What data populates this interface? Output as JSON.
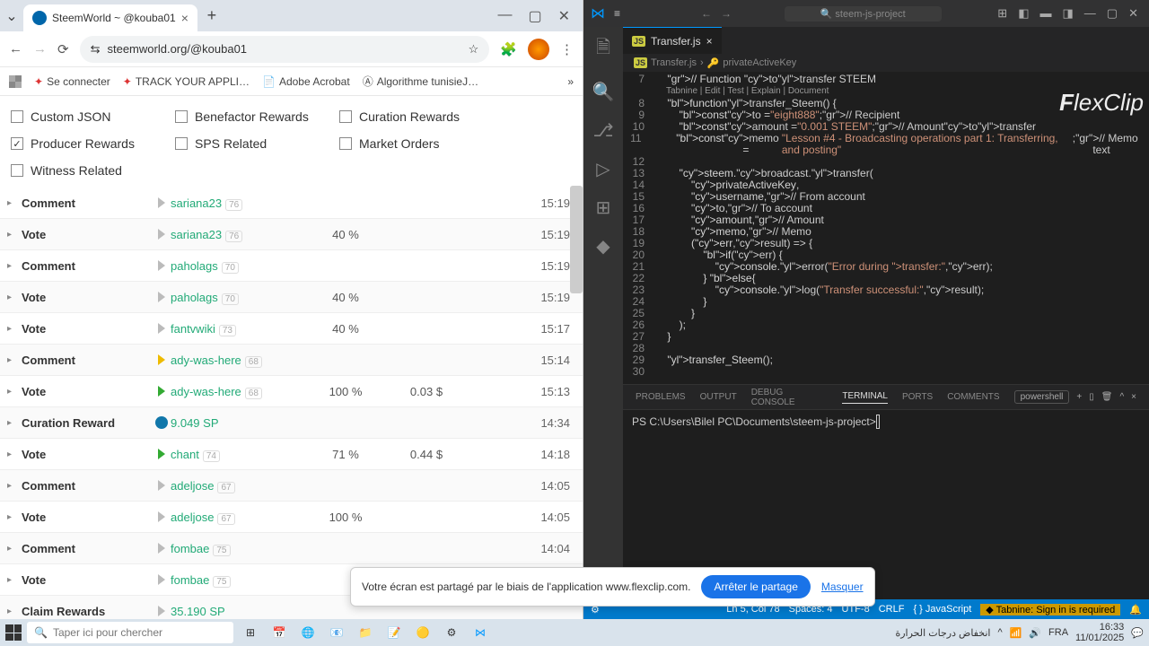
{
  "browser": {
    "tab_title": "SteemWorld ~ @kouba01",
    "url": "steemworld.org/@kouba01",
    "bookmarks": {
      "apps": "",
      "connect": "Se connecter",
      "track": "TRACK YOUR APPLI…",
      "acrobat": "Adobe Acrobat",
      "algo": "Algorithme tunisieJ…"
    },
    "filters": {
      "custom_json": "Custom JSON",
      "benefactor": "Benefactor Rewards",
      "curation": "Curation Rewards",
      "producer": "Producer Rewards",
      "sps": "SPS Related",
      "market": "Market Orders",
      "witness": "Witness Related"
    },
    "ops": [
      {
        "type": "Comment",
        "user": "sariana23",
        "rep": "76",
        "tri": "n",
        "pct": "",
        "amt": "",
        "time": "15:19"
      },
      {
        "type": "Vote",
        "user": "sariana23",
        "rep": "76",
        "tri": "n",
        "pct": "40 %",
        "amt": "",
        "time": "15:19"
      },
      {
        "type": "Comment",
        "user": "paholags",
        "rep": "70",
        "tri": "n",
        "pct": "",
        "amt": "",
        "time": "15:19"
      },
      {
        "type": "Vote",
        "user": "paholags",
        "rep": "70",
        "tri": "n",
        "pct": "40 %",
        "amt": "",
        "time": "15:19"
      },
      {
        "type": "Vote",
        "user": "fantvwiki",
        "rep": "73",
        "tri": "n",
        "pct": "40 %",
        "amt": "",
        "time": "15:17"
      },
      {
        "type": "Comment",
        "user": "ady-was-here",
        "rep": "68",
        "tri": "o",
        "pct": "",
        "amt": "",
        "time": "15:14"
      },
      {
        "type": "Vote",
        "user": "ady-was-here",
        "rep": "68",
        "tri": "g",
        "pct": "100 %",
        "amt": "0.03 $",
        "time": "15:13"
      },
      {
        "type": "Curation Reward",
        "user": "9.049 SP",
        "rep": "",
        "tri": "s",
        "pct": "",
        "amt": "",
        "time": "14:34"
      },
      {
        "type": "Vote",
        "user": "chant",
        "rep": "74",
        "tri": "g",
        "pct": "71 %",
        "amt": "0.44 $",
        "time": "14:18"
      },
      {
        "type": "Comment",
        "user": "adeljose",
        "rep": "67",
        "tri": "n",
        "pct": "",
        "amt": "",
        "time": "14:05"
      },
      {
        "type": "Vote",
        "user": "adeljose",
        "rep": "67",
        "tri": "n",
        "pct": "100 %",
        "amt": "",
        "time": "14:05"
      },
      {
        "type": "Comment",
        "user": "fombae",
        "rep": "75",
        "tri": "n",
        "pct": "",
        "amt": "",
        "time": "14:04"
      },
      {
        "type": "Vote",
        "user": "fombae",
        "rep": "75",
        "tri": "n",
        "pct": "",
        "amt": "",
        "time": ""
      },
      {
        "type": "Claim Rewards",
        "user": "35.190 SP",
        "rep": "",
        "tri": "n",
        "pct": "",
        "amt": "",
        "time": ""
      }
    ]
  },
  "vscode": {
    "search": "steem-js-project",
    "tab": "Transfer.js",
    "breadcrumb_file": "Transfer.js",
    "breadcrumb_sym": "privateActiveKey",
    "codelens": "Tabnine | Edit | Test | Explain | Document",
    "code": [
      {
        "n": "7",
        "t": "    // Function to transfer STEEM",
        "c": "gr"
      },
      {
        "n": "8",
        "t": "    function transfer_Steem() {",
        "c": ""
      },
      {
        "n": "9",
        "t": "        const to = \"eight888\"; // Recipient",
        "c": ""
      },
      {
        "n": "10",
        "t": "        const amount = \"0.001 STEEM\"; // Amount to transfer",
        "c": ""
      },
      {
        "n": "11",
        "t": "        const memo = \"Lesson #4 - Broadcasting operations part 1: Transferring, and posting\"; // Memo text",
        "c": ""
      },
      {
        "n": "12",
        "t": "",
        "c": ""
      },
      {
        "n": "13",
        "t": "        steem.broadcast.transfer(",
        "c": ""
      },
      {
        "n": "14",
        "t": "            privateActiveKey,",
        "c": ""
      },
      {
        "n": "15",
        "t": "            username, // From account",
        "c": ""
      },
      {
        "n": "16",
        "t": "            to, // To account",
        "c": ""
      },
      {
        "n": "17",
        "t": "            amount, // Amount",
        "c": ""
      },
      {
        "n": "18",
        "t": "            memo, // Memo",
        "c": ""
      },
      {
        "n": "19",
        "t": "            (err, result) => {",
        "c": ""
      },
      {
        "n": "20",
        "t": "                if (err) {",
        "c": ""
      },
      {
        "n": "21",
        "t": "                    console.error(\"Error during transfer:\", err);",
        "c": ""
      },
      {
        "n": "22",
        "t": "                } else {",
        "c": ""
      },
      {
        "n": "23",
        "t": "                    console.log(\"Transfer successful:\", result);",
        "c": ""
      },
      {
        "n": "24",
        "t": "                }",
        "c": ""
      },
      {
        "n": "25",
        "t": "            }",
        "c": ""
      },
      {
        "n": "26",
        "t": "        );",
        "c": ""
      },
      {
        "n": "27",
        "t": "    }",
        "c": ""
      },
      {
        "n": "28",
        "t": "",
        "c": ""
      },
      {
        "n": "29",
        "t": "    transfer_Steem();",
        "c": ""
      },
      {
        "n": "30",
        "t": "",
        "c": ""
      }
    ],
    "terminal": {
      "tabs": {
        "problems": "PROBLEMS",
        "output": "OUTPUT",
        "debug": "DEBUG CONSOLE",
        "terminal": "TERMINAL",
        "ports": "PORTS",
        "comments": "COMMENTS"
      },
      "shell": "powershell",
      "prompt": "PS C:\\Users\\Bilel PC\\Documents\\steem-js-project> "
    },
    "status": {
      "pos": "Ln 5, Col 78",
      "spaces": "Spaces: 4",
      "enc": "UTF-8",
      "eol": "CRLF",
      "lang": "JavaScript",
      "tabnine": "Tabnine: Sign in is required"
    }
  },
  "share": {
    "msg": "Votre écran est partagé par le biais de l'application www.flexclip.com.",
    "stop": "Arrêter le partage",
    "mask": "Masquer"
  },
  "taskbar": {
    "search_ph": "Taper ici pour chercher",
    "weather": "انخفاض درجات الحرارة",
    "time": "16:33",
    "date": "11/01/2025"
  }
}
